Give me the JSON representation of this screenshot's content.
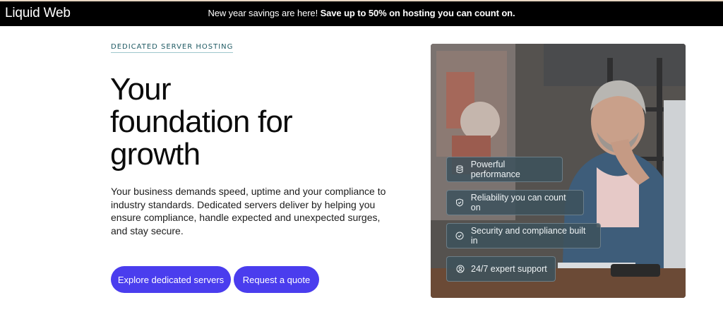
{
  "topbar": {
    "logo": "Liquid Web",
    "promo_text": "New year savings are here! ",
    "promo_bold": "Save up to 50% on hosting you can count on."
  },
  "hero": {
    "eyebrow": "DEDICATED SERVER HOSTING",
    "headline_line1": "Your",
    "headline_line2": "foundation for",
    "headline_line3": "growth",
    "body": "Your business demands speed, uptime and your compliance to industry standards. Dedicated servers deliver by helping you ensure compliance, handle expected and unexpected surges, and stay secure.",
    "primary_button": "Explore dedicated servers",
    "secondary_button": "Request a quote"
  },
  "features": [
    {
      "label": "Powerful performance",
      "icon": "database-icon"
    },
    {
      "label": "Reliability you can count on",
      "icon": "shield-icon"
    },
    {
      "label": "Security and compliance built in",
      "icon": "check-circle-icon"
    },
    {
      "label": "24/7 expert support",
      "icon": "user-circle-icon"
    }
  ],
  "colors": {
    "brand_purple": "#4a3dee",
    "topbar_bg": "#000000",
    "eyebrow_teal": "#1f5a63"
  }
}
